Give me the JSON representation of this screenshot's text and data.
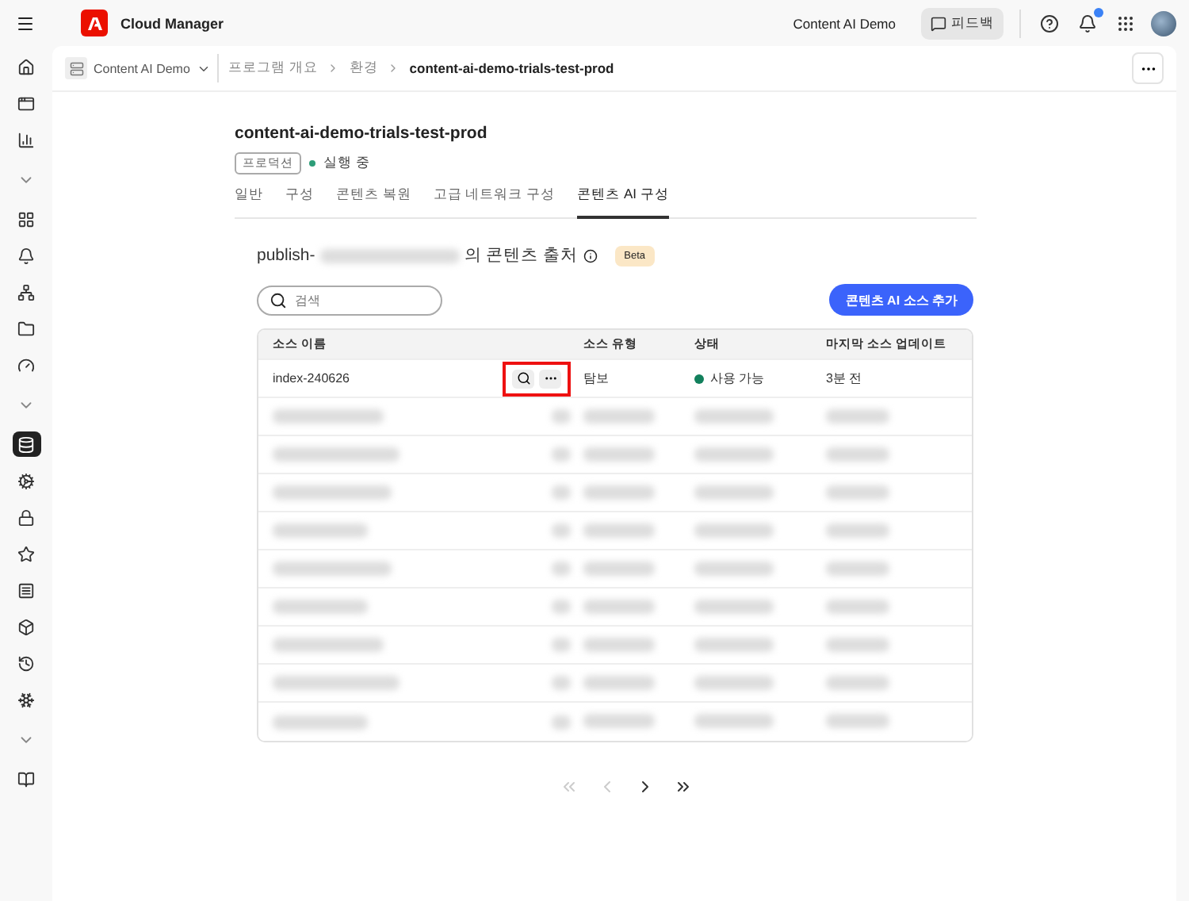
{
  "topbar": {
    "app_name": "Cloud Manager",
    "org": "Content AI Demo",
    "feedback": "피드백",
    "notification_badge": true
  },
  "sidebar": {
    "items": [
      {
        "kind": "icon",
        "selected": false
      },
      {
        "kind": "icon",
        "selected": false
      },
      {
        "kind": "icon",
        "selected": false
      },
      {
        "kind": "chevron",
        "selected": false
      },
      {
        "kind": "icon",
        "selected": false
      },
      {
        "kind": "icon",
        "selected": false
      },
      {
        "kind": "icon",
        "selected": false
      },
      {
        "kind": "icon",
        "selected": false
      },
      {
        "kind": "icon",
        "selected": false
      },
      {
        "kind": "chevron",
        "selected": false
      },
      {
        "kind": "icon",
        "selected": true
      },
      {
        "kind": "icon",
        "selected": false
      },
      {
        "kind": "icon",
        "selected": false
      },
      {
        "kind": "icon",
        "selected": false
      },
      {
        "kind": "icon",
        "selected": false
      },
      {
        "kind": "icon",
        "selected": false
      },
      {
        "kind": "icon",
        "selected": false
      },
      {
        "kind": "icon",
        "selected": false
      },
      {
        "kind": "chevron",
        "selected": false
      },
      {
        "kind": "icon",
        "selected": false
      }
    ]
  },
  "breadcrumb": {
    "program": "Content AI Demo",
    "items": [
      "프로그램 개요",
      "환경",
      "content-ai-demo-trials-test-prod"
    ]
  },
  "environment": {
    "title": "content-ai-demo-trials-test-prod",
    "tag": "프로덕션",
    "status": "실행 중"
  },
  "tabs": [
    {
      "label": "일반",
      "selected": false
    },
    {
      "label": "구성",
      "selected": false
    },
    {
      "label": "콘텐츠 복원",
      "selected": false
    },
    {
      "label": "고급 네트워크 구성",
      "selected": false
    },
    {
      "label": "콘텐츠 AI 구성",
      "selected": true
    }
  ],
  "section": {
    "title_prefix": "publish-",
    "title_suffix": "의 콘텐츠 출처",
    "badge": "Beta"
  },
  "search": {
    "placeholder": "검색"
  },
  "add_button": "콘텐츠 AI 소스 추가",
  "table": {
    "columns": [
      "소스 이름",
      "소스 유형",
      "상태",
      "마지막 소스 업데이트"
    ],
    "rows": [
      {
        "kind": "item",
        "name": "index-240626",
        "type": "탐보",
        "status": "사용 가능",
        "color": "#12805c",
        "updated": "3분 전",
        "highlighted": true
      },
      {
        "kind": "redacted"
      },
      {
        "kind": "redacted"
      },
      {
        "kind": "redacted"
      },
      {
        "kind": "redacted"
      },
      {
        "kind": "redacted"
      },
      {
        "kind": "redacted"
      },
      {
        "kind": "redacted"
      },
      {
        "kind": "redacted"
      },
      {
        "kind": "redacted"
      }
    ]
  },
  "pagination": {
    "first_disabled": true,
    "prev_disabled": true,
    "next_disabled": false,
    "last_disabled": false
  }
}
